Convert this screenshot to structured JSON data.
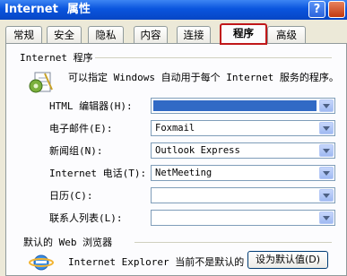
{
  "window": {
    "title_en": "Internet",
    "title_cn": "属性",
    "help_label": "?"
  },
  "tabs": [
    {
      "label": "常规"
    },
    {
      "label": "安全"
    },
    {
      "label": "隐私"
    },
    {
      "label": "内容"
    },
    {
      "label": "连接"
    },
    {
      "label": "程序",
      "active": true
    },
    {
      "label": "高级"
    }
  ],
  "programs": {
    "group_title": "Internet 程序",
    "icon": "gear-document-icon",
    "description": "可以指定 Windows 自动用于每个 Internet 服务的程序。",
    "rows": [
      {
        "label": "HTML 编辑器(H):",
        "value": ""
      },
      {
        "label": "电子邮件(E):",
        "value": "Foxmail"
      },
      {
        "label": "新闻组(N):",
        "value": "Outlook Express"
      },
      {
        "label": "Internet 电话(T):",
        "value": "NetMeeting"
      },
      {
        "label": "日历(C):",
        "value": ""
      },
      {
        "label": "联系人列表(L):",
        "value": ""
      }
    ]
  },
  "browser": {
    "group_title": "默认的 Web 浏览器",
    "icon": "internet-explorer-icon",
    "status_text": "Internet Explorer 当前不是默认的",
    "set_default_label": "设为默认值(D)"
  },
  "colors": {
    "titlebar": "#0a55de",
    "selection": "#316ac5",
    "active_tab_outline": "#c0181a"
  }
}
